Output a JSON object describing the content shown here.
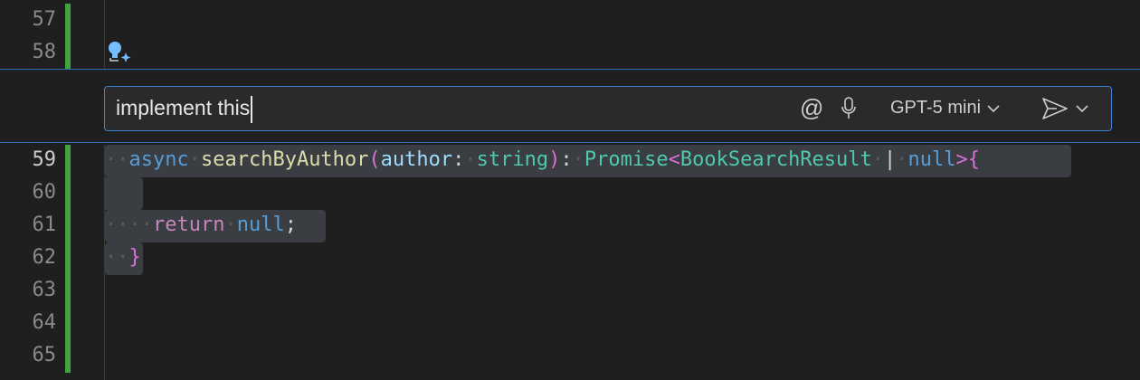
{
  "gutter": {
    "lines": [
      "57",
      "58",
      "59",
      "60",
      "61",
      "62",
      "63",
      "64",
      "65"
    ]
  },
  "inline_chat": {
    "input_value": "implement this",
    "mention_symbol": "@",
    "model_label": "GPT-5 mini",
    "icons": [
      "at-icon",
      "microphone-icon",
      "chevron-down-icon",
      "send-icon",
      "sparkle-icon"
    ]
  },
  "code": {
    "dot": "·",
    "line59": {
      "async": "async",
      "fn_name": "searchByAuthor",
      "open_paren": "(",
      "param": "author",
      "colon": ":",
      "param_type": "string",
      "close_paren": ")",
      "colon2": ":",
      "promise": "Promise",
      "lt": "<",
      "generic": "BookSearchResult",
      "pipe": "|",
      "null_kw": "null",
      "gt_brace": ">{"
    },
    "line61": {
      "return_kw": "return",
      "null_kw": "null",
      "semicolon": ";"
    },
    "line62": {
      "close_brace": "}"
    }
  },
  "colors": {
    "background": "#1f1f1f",
    "git_added": "#3fa33f",
    "focus_border": "#3b83cf",
    "selection": "#3a3d41"
  }
}
